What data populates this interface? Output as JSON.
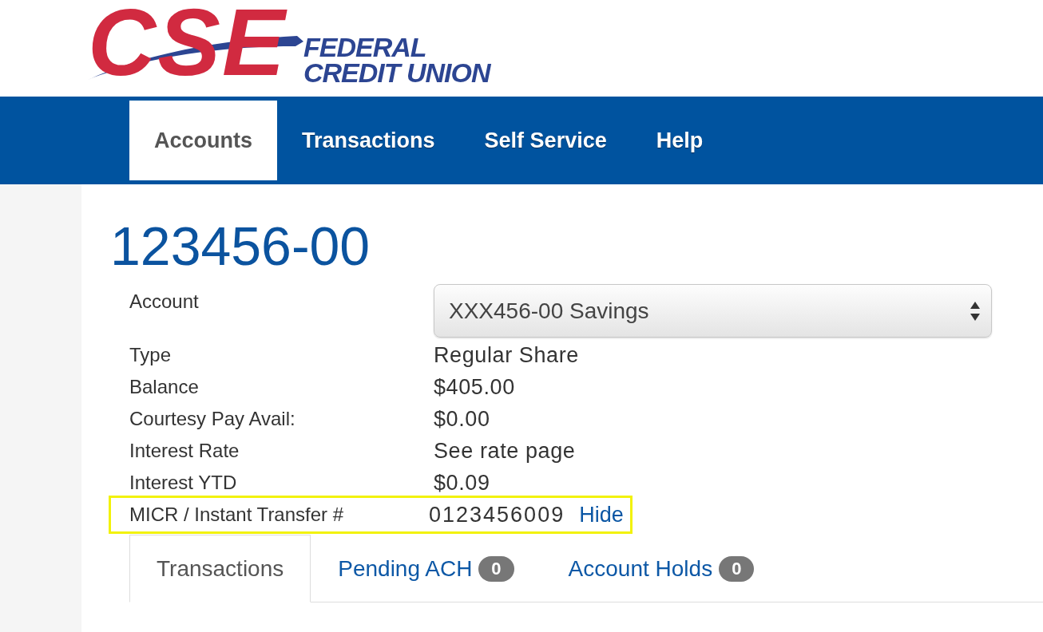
{
  "logo": {
    "mark": "CSE",
    "line_1": "FEDERAL",
    "line_2": "CREDIT UNION"
  },
  "nav": {
    "items": [
      {
        "label": "Accounts",
        "selected": true
      },
      {
        "label": "Transactions",
        "selected": false
      },
      {
        "label": "Self Service",
        "selected": false
      },
      {
        "label": "Help",
        "selected": false
      }
    ]
  },
  "account_title": "123456-00",
  "details": {
    "account_select": {
      "label": "Account",
      "value": "XXX456-00 Savings"
    },
    "rows": [
      {
        "label": "Type",
        "value": "Regular Share",
        "highlighted": false
      },
      {
        "label": "Balance",
        "value": "$405.00",
        "highlighted": false
      },
      {
        "label": "Courtesy Pay Avail:",
        "value": "$0.00",
        "highlighted": false
      },
      {
        "label": "Interest Rate",
        "value": "See rate page",
        "highlighted": false
      },
      {
        "label": "Interest YTD",
        "value": "$0.09",
        "highlighted": false
      },
      {
        "label": "MICR / Instant Transfer #",
        "value": "0123456009",
        "link": "Hide",
        "highlighted": true
      }
    ]
  },
  "tabs": [
    {
      "label": "Transactions",
      "selected": true
    },
    {
      "label": "Pending ACH",
      "count": "0",
      "selected": false
    },
    {
      "label": "Account Holds",
      "count": "0",
      "selected": false
    }
  ]
}
